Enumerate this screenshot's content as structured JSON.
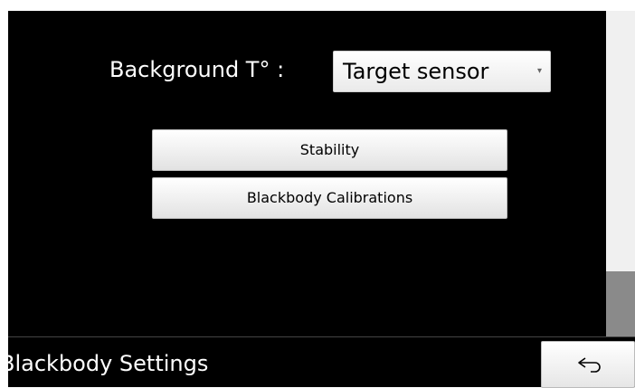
{
  "settings": {
    "background_label": "Background T° :",
    "background_select": {
      "value": "Target sensor",
      "arrow_icon": "dropdown-arrow-icon"
    }
  },
  "actions": {
    "stability_label": "Stability",
    "calibrations_label": "Blackbody Calibrations"
  },
  "footer": {
    "title": "Blackbody Settings",
    "back_icon": "back-arrow-icon"
  },
  "colors": {
    "background": "#000000",
    "text": "#ffffff",
    "button_face": "#f2f2f2",
    "scrollbar_thumb": "#8a8a8a"
  }
}
